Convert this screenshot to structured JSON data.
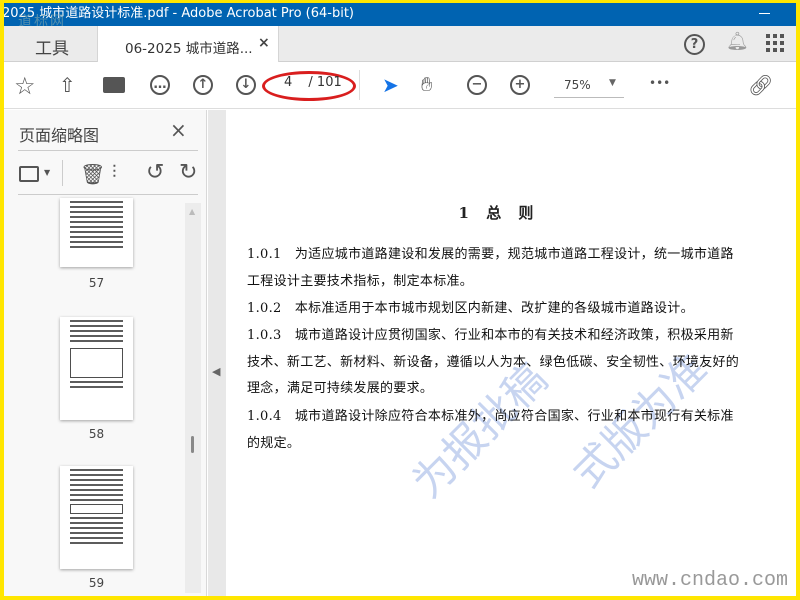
{
  "window": {
    "title": "2025 城市道路设计标准.pdf - Adobe Acrobat Pro (64-bit)",
    "corner_logo": "道标网"
  },
  "tabs": {
    "tools": "工具",
    "document": "06-2025 城市道路...",
    "close": "×"
  },
  "toolbar": {
    "current_page": "4",
    "total_pages": "/ 101",
    "zoom": "75%",
    "more": "•••"
  },
  "icons": [
    "star-icon",
    "cloud-upload-icon",
    "print-icon",
    "search-zoom-icon",
    "page-up-icon",
    "page-down-icon",
    "select-cursor-icon",
    "hand-icon",
    "zoom-out-icon",
    "zoom-in-icon",
    "share-link-icon",
    "help-icon",
    "bell-icon",
    "apps-grid-icon"
  ],
  "highlight_color": "#d91e1e",
  "sidebar": {
    "title": "页面缩略图",
    "close": "×",
    "thumbnails": [
      {
        "label": "57"
      },
      {
        "label": "58"
      },
      {
        "label": "59"
      }
    ]
  },
  "document": {
    "heading": "1 总 则",
    "lines": [
      "1.0.1　为适应城市道路建设和发展的需要，规范城市道路工程设计，统一城市道路",
      "工程设计主要技术指标，制定本标准。",
      "1.0.2　本标准适用于本市城市规划区内新建、改扩建的各级城市道路设计。",
      "1.0.3　城市道路设计应贯彻国家、行业和本市的有关技术和经济政策，积极采用新",
      "技术、新工艺、新材料、新设备，遵循以人为本、绿色低碳、安全韧性、环境友好的",
      "理念，满足可持续发展的要求。",
      "1.0.4　城市道路设计除应符合本标准外，尚应符合国家、行业和本市现行有关标准",
      "的规定。"
    ],
    "watermark_1": "为报批稿",
    "watermark_2": "式版为准",
    "site_watermark": "www.cndao.com"
  }
}
